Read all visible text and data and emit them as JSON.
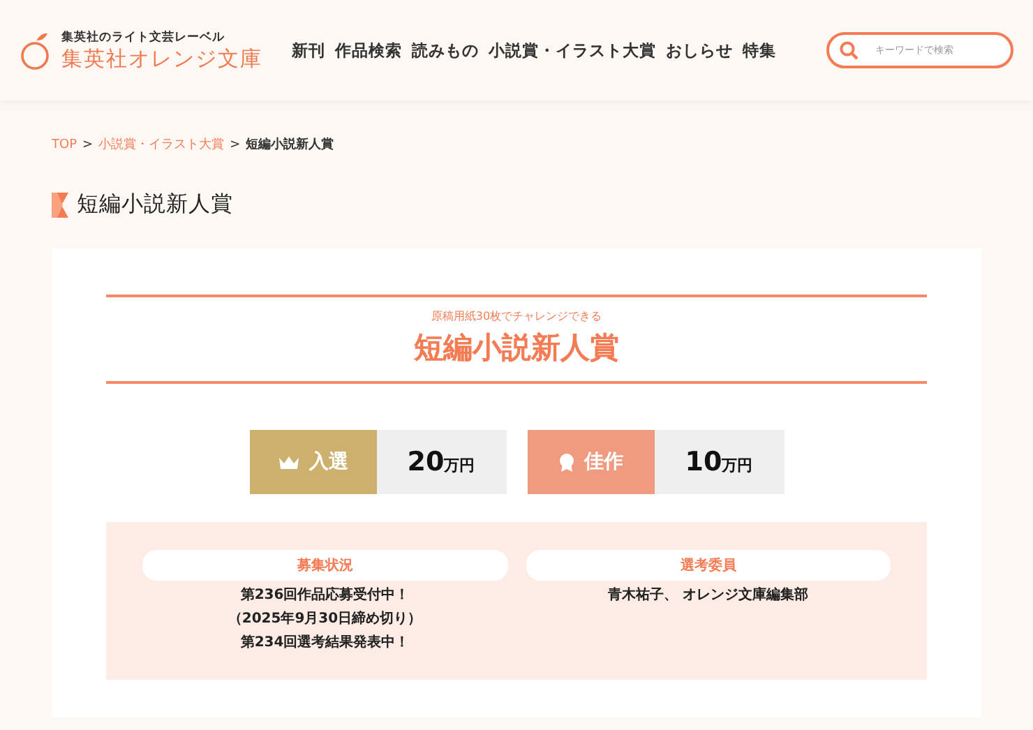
{
  "header": {
    "tagline": "集英社のライト文芸レーベル",
    "logo": "集英社オレンジ文庫",
    "nav": [
      {
        "label": "新刊"
      },
      {
        "label": "作品検索"
      },
      {
        "label": "読みもの"
      },
      {
        "label": "小説賞・イラスト大賞"
      },
      {
        "label": "おしらせ"
      },
      {
        "label": "特集"
      }
    ],
    "search": {
      "placeholder": "キーワードで検索"
    }
  },
  "breadcrumb": [
    {
      "kind": "link",
      "label": "TOP"
    },
    {
      "kind": "separator",
      "label": ">"
    },
    {
      "kind": "link",
      "label": "小説賞・イラスト大賞"
    },
    {
      "kind": "separator",
      "label": ">"
    },
    {
      "kind": "current",
      "label": "短編小説新人賞"
    }
  ],
  "page_title": "短編小説新人賞",
  "award": {
    "subtitle": "原稿用紙30枚でチャレンジできる",
    "title": "短編小説新人賞",
    "prizes": [
      {
        "kind": "crown",
        "color": "#cdb06e",
        "label": "入選",
        "amount": "20",
        "unit": "万円"
      },
      {
        "kind": "medal",
        "color": "#f09a80",
        "label": "佳作",
        "amount": "10",
        "unit": "万円"
      }
    ],
    "info": [
      {
        "heading": "募集状況",
        "lines": [
          "第236回作品応募受付中！",
          "（2025年9月30日締め切り）",
          "第234回選考結果発表中！"
        ]
      },
      {
        "heading": "選考委員",
        "lines": [
          "青木祐子、 オレンジ文庫編集部"
        ]
      }
    ]
  }
}
